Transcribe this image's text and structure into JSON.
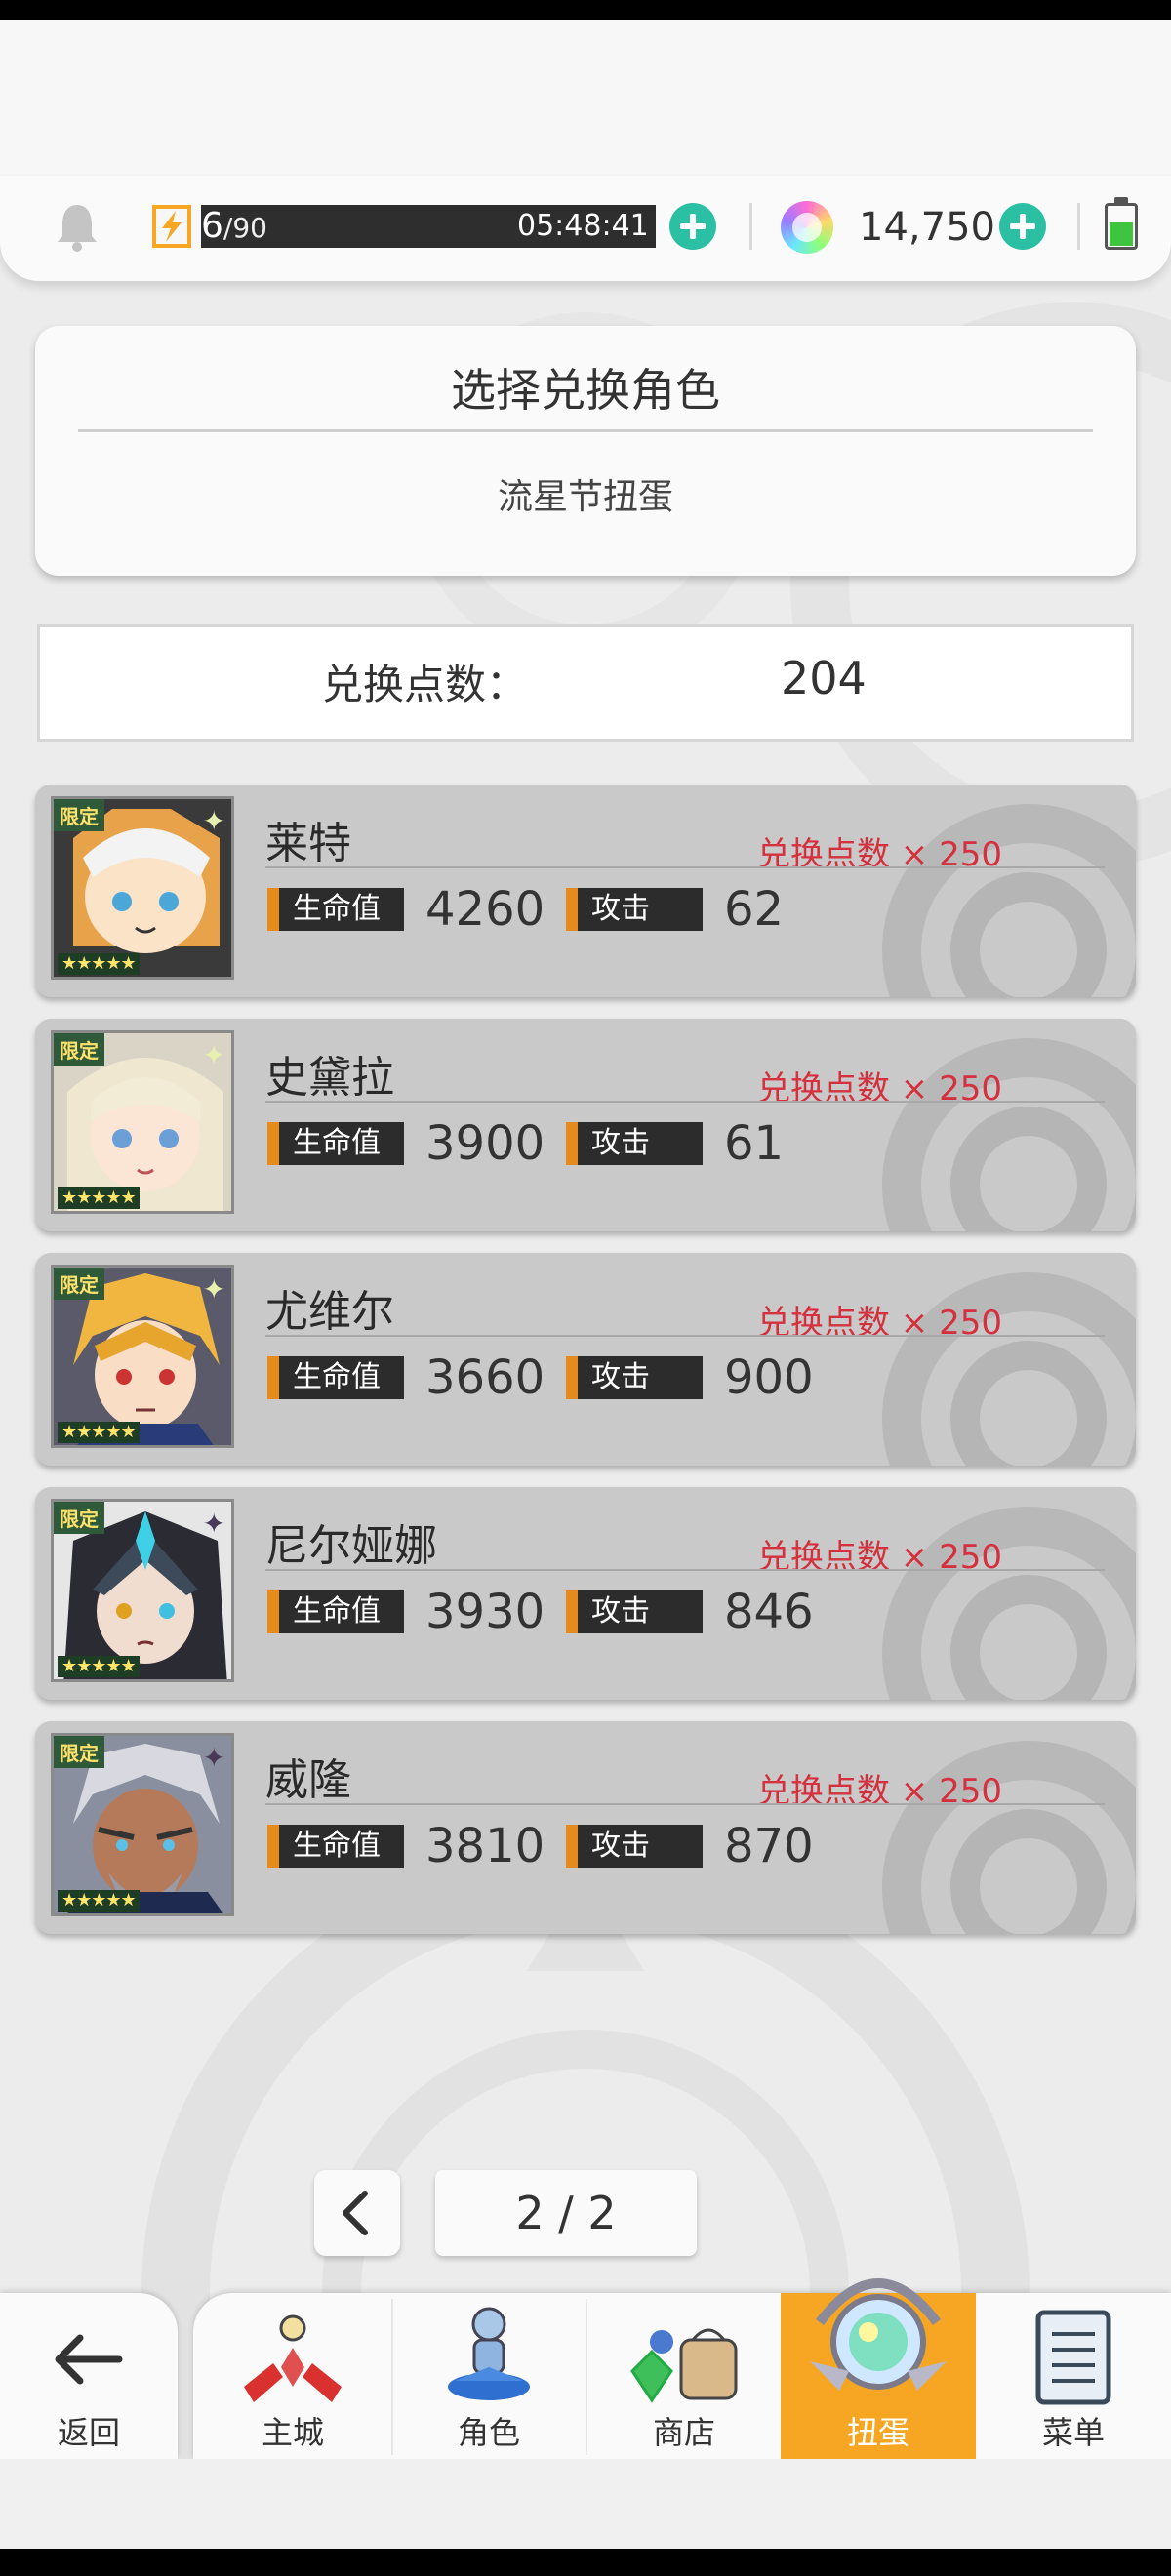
{
  "resources": {
    "stamina_current": "6",
    "stamina_max": "/90",
    "stamina_timer": "05:48:41",
    "gems": "14,750"
  },
  "title_card": {
    "title": "选择兑换角色",
    "subtitle": "流星节扭蛋"
  },
  "points": {
    "label": "兑换点数：",
    "value": "204"
  },
  "characters": [
    {
      "name": "莱特",
      "tag": "限定",
      "stars": "★★★★★",
      "hp_label": "生命值",
      "hp": "4260",
      "atk_label": "攻击",
      "atk": "62",
      "cost": "兑换点数 × 250"
    },
    {
      "name": "史黛拉",
      "tag": "限定",
      "stars": "★★★★★",
      "hp_label": "生命值",
      "hp": "3900",
      "atk_label": "攻击",
      "atk": "61",
      "cost": "兑换点数 × 250"
    },
    {
      "name": "尤维尔",
      "tag": "限定",
      "stars": "★★★★★",
      "hp_label": "生命值",
      "hp": "3660",
      "atk_label": "攻击",
      "atk": "900",
      "cost": "兑换点数 × 250"
    },
    {
      "name": "尼尔娅娜",
      "tag": "限定",
      "stars": "★★★★★",
      "hp_label": "生命值",
      "hp": "3930",
      "atk_label": "攻击",
      "atk": "846",
      "cost": "兑换点数 × 250"
    },
    {
      "name": "威隆",
      "tag": "限定",
      "stars": "★★★★★",
      "hp_label": "生命值",
      "hp": "3810",
      "atk_label": "攻击",
      "atk": "870",
      "cost": "兑换点数 × 250"
    }
  ],
  "pagination": {
    "page": "2 / 2"
  },
  "nav": {
    "back": "返回",
    "items": [
      "主城",
      "角色",
      "商店",
      "扭蛋",
      "菜单"
    ],
    "active": "扭蛋"
  },
  "colors": {
    "accent_orange": "#f6a623",
    "plus_teal": "#2bbfa4",
    "cost_red": "#d4303e",
    "card_gray": "#c9c9c9"
  }
}
